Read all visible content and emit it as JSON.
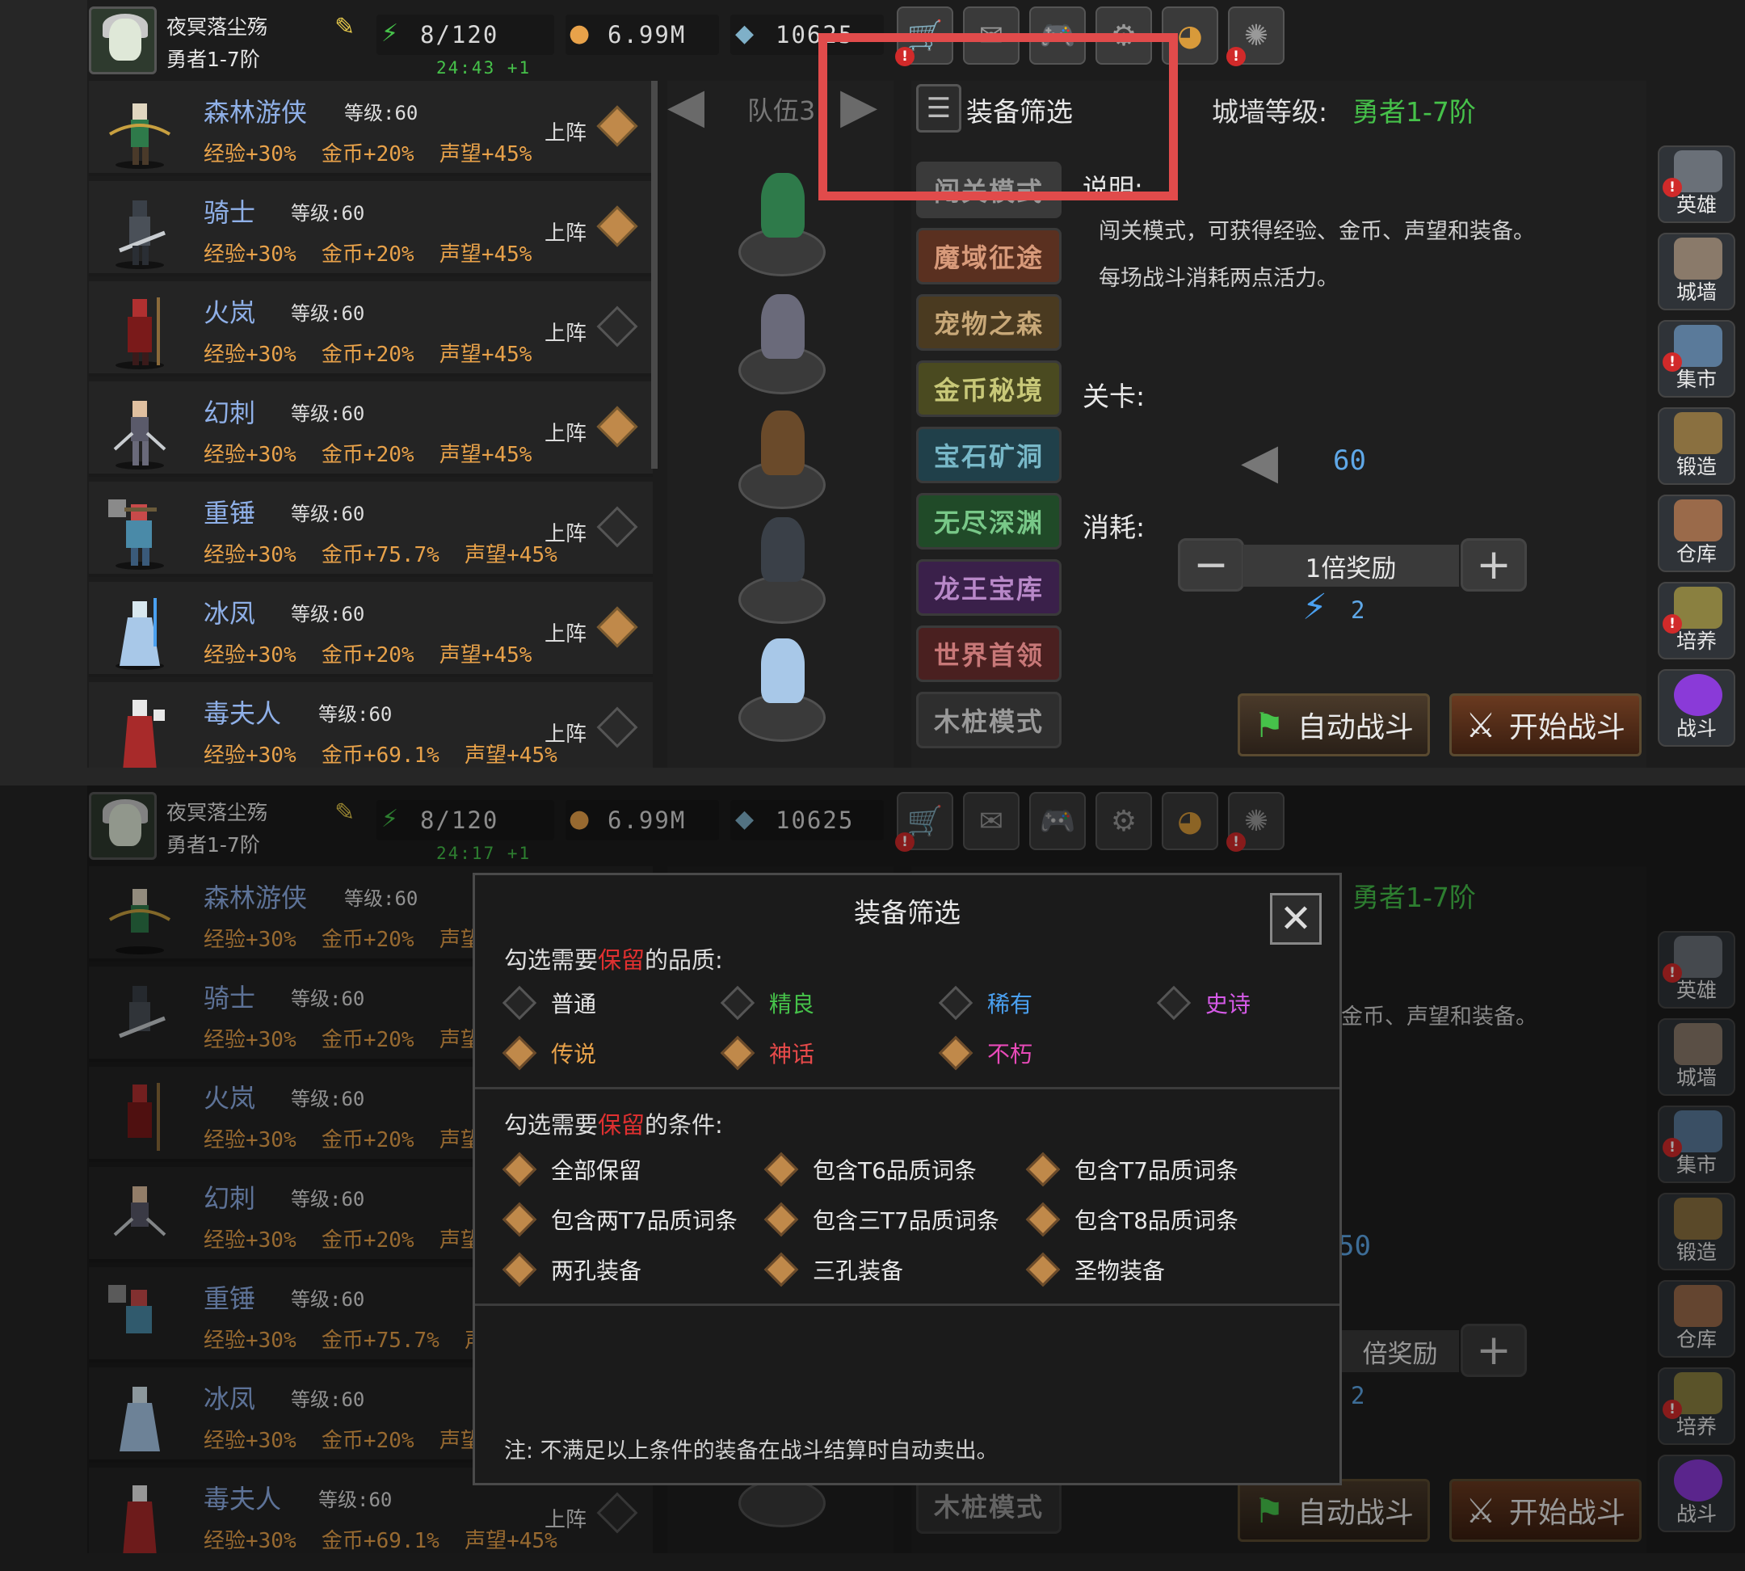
{
  "player": {
    "name": "夜冥落尘殇",
    "rank": "勇者1-7阶"
  },
  "stats": {
    "energy": "8/120",
    "gold": "6.99M",
    "gems": "10625",
    "gems_cut": "10625"
  },
  "timers": {
    "a": "24:43 +1",
    "b": "24:17 +1"
  },
  "toolbar": {
    "shop_icon": "cart-icon",
    "mail_icon": "mail-icon",
    "gamepad_icon": "gamepad-icon",
    "settings_icon": "gear-icon",
    "wheel_icon": "color-wheel-icon",
    "firework_icon": "firework-icon"
  },
  "heroes": [
    {
      "name": "森林游侠",
      "level": "等级:60",
      "stats": "经验+30%  金币+20%  声望+45%",
      "deploy": "上阵",
      "selected": true
    },
    {
      "name": "骑士",
      "level": "等级:60",
      "stats": "经验+30%  金币+20%  声望+45%",
      "deploy": "上阵",
      "selected": true
    },
    {
      "name": "火岚",
      "level": "等级:60",
      "stats": "经验+30%  金币+20%  声望+45%",
      "deploy": "上阵",
      "selected": false
    },
    {
      "name": "幻刺",
      "level": "等级:60",
      "stats": "经验+30%  金币+20%  声望+45%",
      "deploy": "上阵",
      "selected": true
    },
    {
      "name": "重锤",
      "level": "等级:60",
      "stats": "经验+30%  金币+75.7%  声望+45%",
      "deploy": "上阵",
      "selected": false
    },
    {
      "name": "冰凤",
      "level": "等级:60",
      "stats": "经验+30%  金币+20%  声望+45%",
      "deploy": "上阵",
      "selected": true
    },
    {
      "name": "毒夫人",
      "level": "等级:60",
      "stats": "经验+30%  金币+69.1%  声望+45%",
      "deploy": "上阵",
      "selected": false
    }
  ],
  "team": {
    "label": "队伍3"
  },
  "filter": {
    "label": "装备筛选",
    "icon": "list-icon"
  },
  "wall": {
    "label": "城墙等级:",
    "value": "勇者1-7阶"
  },
  "modes": [
    "闯关模式",
    "魔域征途",
    "宠物之森",
    "金币秘境",
    "宝石矿洞",
    "无尽深渊",
    "龙王宝库",
    "世界首领",
    "木桩模式"
  ],
  "description": {
    "label": "说明:",
    "line1": "闯关模式，可获得经验、金币、声望和装备。",
    "line2": "每场战斗消耗两点活力。"
  },
  "stage": {
    "label": "关卡:",
    "value": "60"
  },
  "cost": {
    "label": "消耗:",
    "multiplier": "1倍奖励",
    "energy": "2"
  },
  "buttons": {
    "auto": "自动战斗",
    "start": "开始战斗"
  },
  "sidebar": [
    "英雄",
    "城墙",
    "集市",
    "锻造",
    "仓库",
    "培养",
    "战斗"
  ],
  "dialog": {
    "title": "装备筛选",
    "quality_prefix": "勾选需要",
    "keep": "保留",
    "quality_suffix": "的品质:",
    "cond_prefix": "勾选需要",
    "cond_suffix": "的条件:",
    "qualities": [
      {
        "label": "普通",
        "color": "#e8e8e8",
        "checked": false
      },
      {
        "label": "精良",
        "color": "#46c24a",
        "checked": false
      },
      {
        "label": "稀有",
        "color": "#4aa0f0",
        "checked": false
      },
      {
        "label": "史诗",
        "color": "#d65ae8",
        "checked": false
      },
      {
        "label": "传说",
        "color": "#e8a24a",
        "checked": true
      },
      {
        "label": "神话",
        "color": "#e84a4a",
        "checked": true
      },
      {
        "label": "不朽",
        "color": "#e84ab8",
        "checked": true
      }
    ],
    "conditions": [
      "全部保留",
      "包含T6品质词条",
      "包含T7品质词条",
      "包含两T7品质词条",
      "包含三T7品质词条",
      "包含T8品质词条",
      "两孔装备",
      "三孔装备",
      "圣物装备"
    ],
    "note": "注:  不满足以上条件的装备在战斗结算时自动卖出。"
  },
  "cutoff": {
    "desc_tail": "金币、声望和装备。",
    "stage_tail": "50",
    "mult_tail": "倍奖励"
  }
}
